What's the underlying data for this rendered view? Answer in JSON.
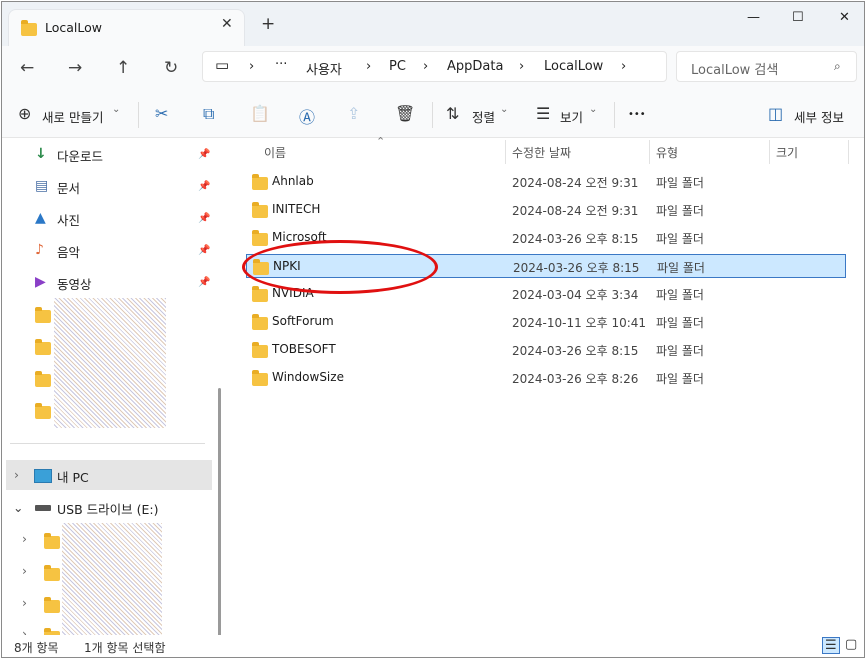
{
  "tab": {
    "title": "LocalLow",
    "close": "✕",
    "new": "+"
  },
  "window_controls": {
    "minimize": "—",
    "maximize": "☐",
    "close": "✕"
  },
  "nav": {
    "back": "←",
    "forward": "→",
    "up": "↑",
    "refresh": "↻"
  },
  "address": {
    "pc_icon": "▭",
    "sep": "›",
    "more": "···",
    "crumbs": [
      "사용자",
      "PC",
      "AppData",
      "LocalLow"
    ]
  },
  "search": {
    "placeholder": "LocalLow 검색",
    "icon": "⌕"
  },
  "toolbar": {
    "new": "새로 만들기",
    "new_chev": "⌄",
    "sort": "정렬",
    "sort_chev": "⌄",
    "view": "보기",
    "view_chev": "⌄",
    "more": "•••",
    "details": "세부 정보",
    "icons": {
      "add": "⊕",
      "cut": "✂",
      "copy": "⧉",
      "paste": "📋",
      "rename": "Ⓐ",
      "share": "⇪",
      "delete": "🗑",
      "sort": "⇅",
      "view": "☰",
      "details": "◫"
    }
  },
  "sidebar": {
    "items": [
      {
        "label": "다운로드",
        "icon": "↓",
        "color": "#2a8a4a"
      },
      {
        "label": "문서",
        "icon": "▤",
        "color": "#4a6fa5"
      },
      {
        "label": "사진",
        "icon": "▲",
        "color": "#2b78c7"
      },
      {
        "label": "음악",
        "icon": "♪",
        "color": "#e0683a"
      },
      {
        "label": "동영상",
        "icon": "▶",
        "color": "#8a3fc7"
      }
    ],
    "pin": "📌",
    "mypc": "내 PC",
    "expand": "›",
    "collapse": "⌄",
    "usb": "USB 드라이브 (E:)"
  },
  "columns": {
    "name": "이름",
    "modified": "수정한 날짜",
    "type": "유형",
    "size": "크기",
    "sort_arrow": "⌃"
  },
  "files": [
    {
      "name": "Ahnlab",
      "date": "2024-08-24 오전 9:31",
      "type": "파일 폴더"
    },
    {
      "name": "INITECH",
      "date": "2024-08-24 오전 9:31",
      "type": "파일 폴더"
    },
    {
      "name": "Microsoft",
      "date": "2024-03-26 오후 8:15",
      "type": "파일 폴더"
    },
    {
      "name": "NPKI",
      "date": "2024-03-26 오후 8:15",
      "type": "파일 폴더"
    },
    {
      "name": "NVIDIA",
      "date": "2024-03-04 오후 3:34",
      "type": "파일 폴더"
    },
    {
      "name": "SoftForum",
      "date": "2024-10-11 오후 10:41",
      "type": "파일 폴더"
    },
    {
      "name": "TOBESOFT",
      "date": "2024-03-26 오후 8:15",
      "type": "파일 폴더"
    },
    {
      "name": "WindowSize",
      "date": "2024-03-26 오후 8:26",
      "type": "파일 폴더"
    }
  ],
  "status": {
    "count": "8개 항목",
    "selected": "1개 항목 선택함",
    "view_details": "☰",
    "view_tiles": "▢"
  }
}
